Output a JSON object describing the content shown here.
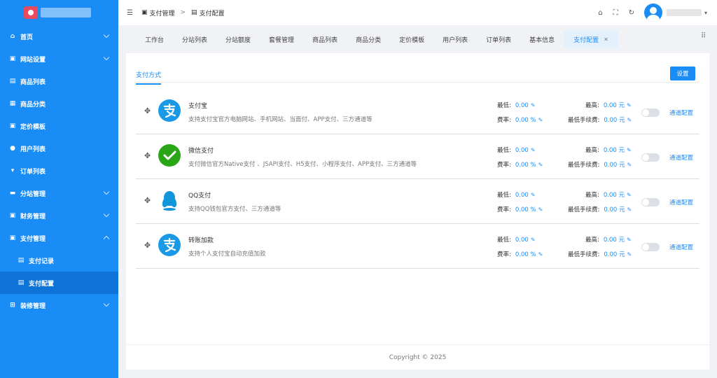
{
  "sidebar": {
    "items": [
      {
        "icon": "home-icon",
        "glyph": "⌂",
        "label": "首页",
        "expandable": true
      },
      {
        "icon": "website-settings-icon",
        "glyph": "▣",
        "label": "网站设置",
        "expandable": true
      },
      {
        "icon": "product-list-icon",
        "glyph": "▤",
        "label": "商品列表",
        "expandable": false
      },
      {
        "icon": "category-icon",
        "glyph": "▦",
        "label": "商品分类",
        "expandable": false
      },
      {
        "icon": "pricing-template-icon",
        "glyph": "▣",
        "label": "定价模板",
        "expandable": false
      },
      {
        "icon": "user-icon",
        "glyph": "●",
        "label": "用户列表",
        "expandable": false
      },
      {
        "icon": "cart-icon",
        "glyph": "▾",
        "label": "订单列表",
        "expandable": false
      },
      {
        "icon": "branch-icon",
        "glyph": "▬",
        "label": "分站管理",
        "expandable": true
      },
      {
        "icon": "finance-icon",
        "glyph": "▣",
        "label": "财务管理",
        "expandable": true
      },
      {
        "icon": "payment-management-icon",
        "glyph": "▣",
        "label": "支付管理",
        "expandable": true,
        "expanded": true
      },
      {
        "icon": "decoration-icon",
        "glyph": "⊞",
        "label": "装修管理",
        "expandable": true
      }
    ],
    "sub_items": [
      {
        "icon": "payment-record-icon",
        "glyph": "▤",
        "label": "支付记录"
      },
      {
        "icon": "payment-config-icon",
        "glyph": "▤",
        "label": "支付配置",
        "active": true
      }
    ]
  },
  "header": {
    "breadcrumb": [
      "支付管理",
      "支付配置"
    ],
    "breadcrumb_sep": ">"
  },
  "tabs": [
    {
      "label": "工作台"
    },
    {
      "label": "分站列表"
    },
    {
      "label": "分站额度"
    },
    {
      "label": "套餐管理"
    },
    {
      "label": "商品列表"
    },
    {
      "label": "商品分类"
    },
    {
      "label": "定价模板"
    },
    {
      "label": "用户列表"
    },
    {
      "label": "订单列表"
    },
    {
      "label": "基本信息"
    },
    {
      "label": "支付配置",
      "active": true,
      "closable": true
    }
  ],
  "card": {
    "tab_label": "支付方式",
    "settings_label": "设置"
  },
  "fee_labels": {
    "min": "最低:",
    "max": "最高:",
    "rate": "费率:",
    "min_fee": "最低手续费:"
  },
  "payments": [
    {
      "name": "支付宝",
      "logo": "alipay",
      "description": "支持支付宝官方电脑网站、手机网站、当面付、APP支付、三方通道等",
      "min": "0.00",
      "max": "0.00 元",
      "rate": "0.00 %",
      "min_fee": "0.00 元",
      "enabled": false,
      "config_label": "通道配置"
    },
    {
      "name": "微信支付",
      "logo": "wechat",
      "description": "支付微信官方Native支付 、JSAPI支付、H5支付、小程序支付、APP支付、三方通道等",
      "min": "0.00",
      "max": "0.00 元",
      "rate": "0.00 %",
      "min_fee": "0.00 元",
      "enabled": false,
      "config_label": "通道配置"
    },
    {
      "name": "QQ支付",
      "logo": "qq",
      "description": "支持QQ钱包官方支付、三方通道等",
      "min": "0.00",
      "max": "0.00 元",
      "rate": "0.00 %",
      "min_fee": "0.00 元",
      "enabled": false,
      "config_label": "通道配置"
    },
    {
      "name": "转账加款",
      "logo": "alipay",
      "description": "支持个人支付宝自动充值加款",
      "min": "0.00",
      "max": "0.00 元",
      "rate": "0.00 %",
      "min_fee": "0.00 元",
      "enabled": false,
      "config_label": "通道配置"
    }
  ],
  "footer": {
    "text": "Copyright © 2025"
  },
  "colors": {
    "primary": "#1a8cf6",
    "alipay": "#1a9ae6",
    "wechat": "#2aa515",
    "qq": "#1296db"
  }
}
